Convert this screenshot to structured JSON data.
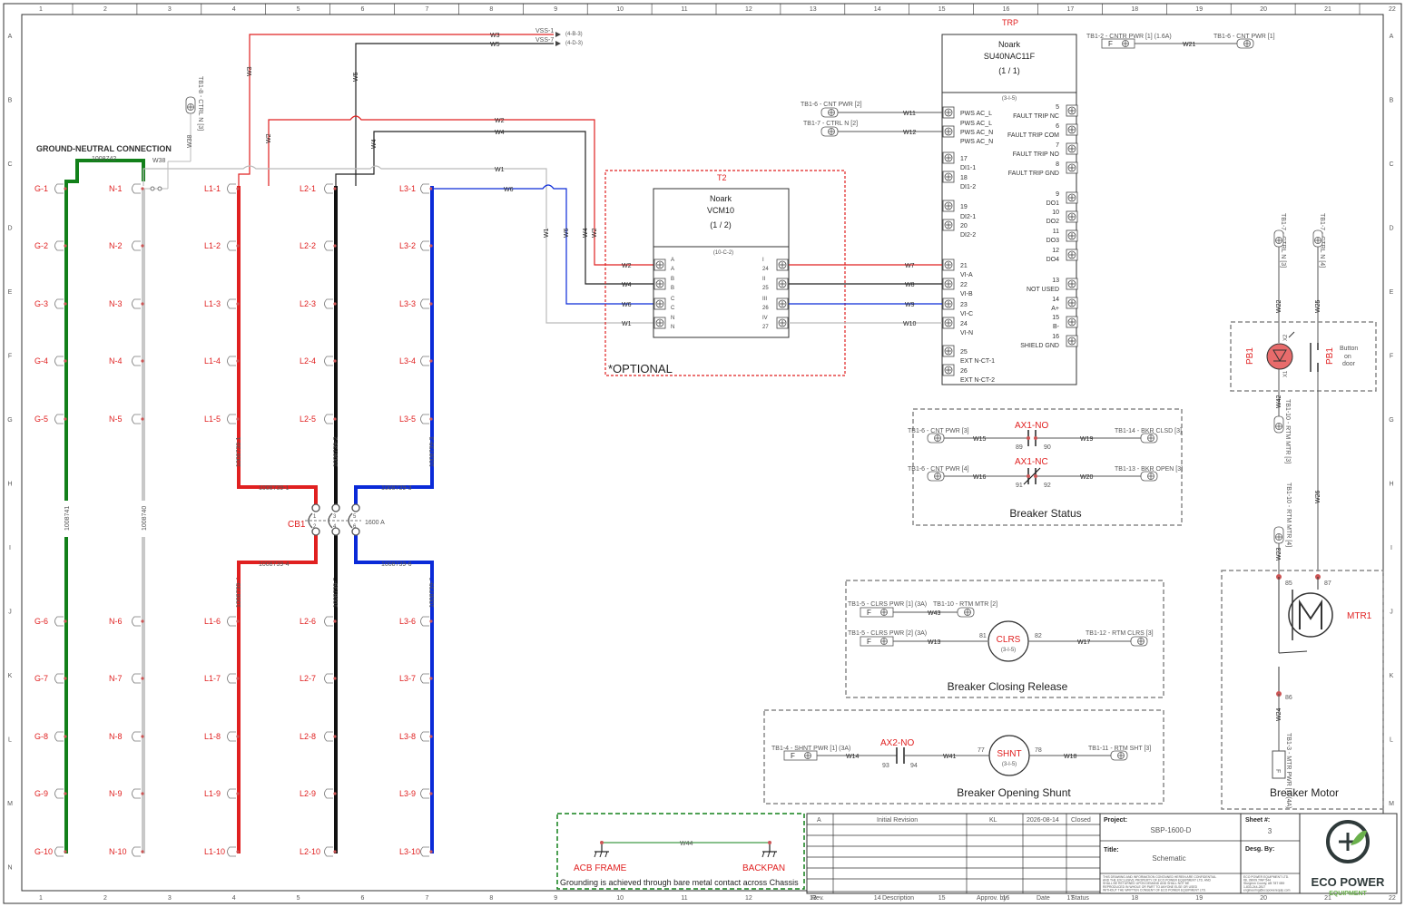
{
  "grid": {
    "cols": [
      "1",
      "2",
      "3",
      "4",
      "5",
      "6",
      "7",
      "8",
      "9",
      "10",
      "11",
      "12",
      "13",
      "14",
      "15",
      "16",
      "17",
      "18",
      "19",
      "20",
      "21",
      "22"
    ],
    "rows": [
      "A",
      "B",
      "C",
      "D",
      "E",
      "F",
      "G",
      "H",
      "I",
      "J",
      "K",
      "L",
      "M",
      "N"
    ]
  },
  "colors": {
    "red": "#e02020",
    "black": "#1a1a1a",
    "blue": "#0a2ad8",
    "green": "#12801a",
    "gray": "#c8c8c8",
    "dash_gray": "#8a8a8a",
    "dash_red": "#e02020"
  },
  "ground_neutral": {
    "title": "GROUND-NEUTRAL CONNECTION",
    "link_part": "1008742",
    "w38": "W38",
    "tb_label": "TB1-8 - CTRL N [3]"
  },
  "bus": {
    "g": [
      "G-1",
      "G-2",
      "G-3",
      "G-4",
      "G-5",
      "G-6",
      "G-7",
      "G-8",
      "G-9",
      "G-10"
    ],
    "n": [
      "N-1",
      "N-2",
      "N-3",
      "N-4",
      "N-5",
      "N-6",
      "N-7",
      "N-8",
      "N-9",
      "N-10"
    ],
    "l1": [
      "L1-1",
      "L1-2",
      "L1-3",
      "L1-4",
      "L1-5",
      "L1-6",
      "L1-7",
      "L1-8",
      "L1-9",
      "L1-10"
    ],
    "l2": [
      "L2-1",
      "L2-2",
      "L2-3",
      "L2-4",
      "L2-5",
      "L2-6",
      "L2-7",
      "L2-8",
      "L2-9",
      "L2-10"
    ],
    "l3": [
      "L3-1",
      "L3-2",
      "L3-3",
      "L3-4",
      "L3-5",
      "L3-6",
      "L3-7",
      "L3-8",
      "L3-9",
      "L3-10"
    ],
    "g_part": "1008741",
    "n_part": "1008740",
    "upper_parts": [
      "1008739-1",
      "1008739-2",
      "1008739-3"
    ],
    "lower_parts": [
      "1008739-4",
      "1008739-5",
      "1008739-6"
    ]
  },
  "breaker": {
    "tag": "CB1",
    "rating": "1600 A",
    "poles": [
      "1",
      "2",
      "3",
      "4",
      "5",
      "6"
    ]
  },
  "wires": {
    "w3": "W3",
    "w5": "W5",
    "w2": "W2",
    "w4": "W4",
    "w1": "W1",
    "w6": "W6",
    "vss1": "VSS-1",
    "vss1_ref": "(4-B-3)",
    "vss7": "VSS-7",
    "vss7_ref": "(4-D-3)"
  },
  "t2": {
    "tag": "T2",
    "maker": "Noark",
    "model": "VCM10",
    "pages": "(1 / 2)",
    "ref": "(10-C-2)",
    "optional": "*OPTIONAL",
    "left_pins": [
      "A",
      "A",
      "B",
      "B",
      "C",
      "C",
      "N",
      "N"
    ],
    "right_pins": [
      "I",
      "24",
      "II",
      "25",
      "III",
      "26",
      "IV",
      "27"
    ],
    "in_wires": [
      "W2",
      "W4",
      "W6",
      "W1"
    ],
    "out_wires": [
      "W7",
      "W8",
      "W9",
      "W10"
    ]
  },
  "trp": {
    "tag": "TRP",
    "maker": "Noark",
    "model": "SU40NAC11F",
    "pages": "(1 / 1)",
    "ref": "(3-I-5)",
    "tb_top": "TB1-2 - CNTR PWR [1] (1.6A)",
    "w21": "W21",
    "tb_top_r": "TB1-6 - CNT PWR [1]",
    "tb_pws1": "TB1-6 - CNT PWR [2]",
    "w11": "W11",
    "tb_pws2": "TB1-7 - CTRL N [2]",
    "w12": "W12",
    "left_terms": [
      "PWS AC_L",
      "PWS AC_L",
      "PWS AC_N",
      "PWS AC_N",
      "17",
      "DI1-1",
      "18",
      "DI1-2",
      "19",
      "DI2-1",
      "20",
      "DI2-2",
      "21",
      "VI-A",
      "22",
      "VI-B",
      "23",
      "VI-C",
      "24",
      "VI-N",
      "25",
      "EXT N-CT-1",
      "26",
      "EXT N-CT-2"
    ],
    "right_terms": [
      "5",
      "FAULT TRIP NC",
      "6",
      "FAULT TRIP COM",
      "7",
      "FAULT TRIP NO",
      "8",
      "FAULT TRIP GND",
      "9",
      "DO1",
      "10",
      "DO2",
      "11",
      "DO3",
      "12",
      "DO4",
      "13",
      "NOT USED",
      "14",
      "A+",
      "15",
      "B-",
      "16",
      "SHIELD GND"
    ]
  },
  "breaker_status": {
    "title": "Breaker Status",
    "no_tag": "AX1-NO",
    "nc_tag": "AX1-NC",
    "row1": {
      "tb_l": "TB1-6 - CNT PWR [3]",
      "w_l": "W15",
      "p1": "89",
      "p2": "90",
      "w_r": "W19",
      "tb_r": "TB1-14 - BKR CLSD [3]"
    },
    "row2": {
      "tb_l": "TB1-6 - CNT PWR [4]",
      "w_l": "W16",
      "p1": "91",
      "p2": "92",
      "w_r": "W20",
      "tb_r": "TB1-13 - BKR OPEN [3]"
    }
  },
  "closing": {
    "title": "Breaker Closing Release",
    "tb1": "TB1-5 - CLRS PWR [1] (3A)",
    "tb2": "TB1-10 - RTM MTR [2]",
    "w43": "W43",
    "tb3": "TB1-5 - CLRS PWR [2] (3A)",
    "w13": "W13",
    "p81": "81",
    "coil": "CLRS",
    "coil_ref": "(3-I-5)",
    "p82": "82",
    "w17": "W17",
    "tb4": "TB1-12 - RTM CLRS [3]"
  },
  "shunt": {
    "title": "Breaker Opening Shunt",
    "tb1": "TB1-4 - SHNT PWR [1] (3A)",
    "w14": "W14",
    "ax": "AX2-NO",
    "p93": "93",
    "p94": "94",
    "w41": "W41",
    "p77": "77",
    "coil": "SHNT",
    "coil_ref": "(3-I-5)",
    "p78": "78",
    "w18": "W18",
    "tb2": "TB1-11 - RTM SHT [3]"
  },
  "pb": {
    "tb1": "TB1-7 - CTRL N [3]",
    "tb2": "TB1-7 - CTRL N [4]",
    "w22": "W22",
    "w25": "W25",
    "tag": "PB1",
    "x1": "X1",
    "x2": "X2",
    "note": [
      "Button",
      "on",
      "door"
    ],
    "w42": "W42",
    "tb3": "TB1-10 - RTM MTR [3]"
  },
  "motor": {
    "title": "Breaker Motor",
    "w26": "W26",
    "tb_a": "TB1-10 - RTM MTR [4]",
    "w23": "W23",
    "p85": "85",
    "p87": "87",
    "tag": "MTR1",
    "p86": "86",
    "w24": "W24",
    "tb_b": "TB1-3 - MTR PWR [1] (4A)"
  },
  "grounding": {
    "w44": "W44",
    "left": "ACB FRAME",
    "right": "BACKPAN",
    "note": "Grounding is achieved through bare metal contact across Chassis"
  },
  "title_block": {
    "rev": "A",
    "desc": "Initial Revision",
    "by": "KL",
    "date": "2026-08-14",
    "status": "Closed",
    "col_rev": "Rev.",
    "col_desc": "Description",
    "col_appr": "Approv. by",
    "col_date": "Date",
    "col_status": "Status",
    "project_label": "Project:",
    "project": "SBP-1600-D",
    "title_label": "Title:",
    "title": "Schematic",
    "sheet_label": "Sheet #:",
    "sheet": "3",
    "desg_label": "Desg. By:",
    "disclaimer": [
      "THIS DRAWING AND INFORMATION CONTAINED HEREIN ARE CONFIDENTIAL",
      "AND THE EXCLUSIVE PROPERTY OF ECO POWER EQUIPMENT LTD. AND",
      "SHALL BE RETURNED UPON DEMAND AND SHALL NOT BE",
      "REPRODUCED IN WHOLE OR PART TO ANYONE ELSE OR USED",
      "WITHOUT THE WRITTEN CONSENT OF ECO POWER EQUIPMENT LTD."
    ],
    "company_lines": [
      "ECO POWER EQUIPMENT LTD.",
      "#8, 28009 TWP 544",
      "Sturgeon County, AB T8T 0B9",
      "1-833-244-2817",
      "engineering@ecopowerequip.com"
    ],
    "logo_top": "ECO POWER",
    "logo_bottom": "EQUIPMENT"
  }
}
